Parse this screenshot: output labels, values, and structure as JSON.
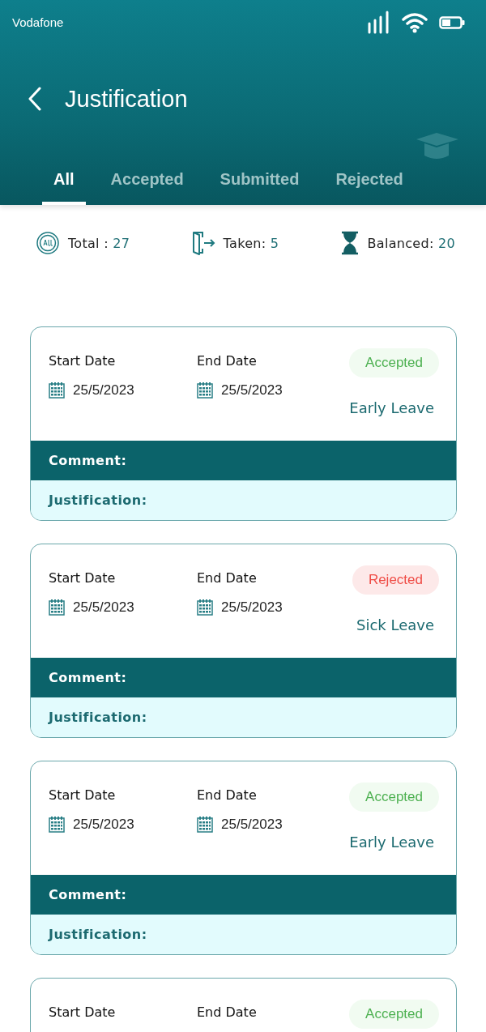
{
  "status_bar": {
    "carrier": "Vodafone"
  },
  "header": {
    "title": "Justification"
  },
  "tabs": [
    {
      "label": "All",
      "selected": true
    },
    {
      "label": "Accepted",
      "selected": false
    },
    {
      "label": "Submitted",
      "selected": false
    },
    {
      "label": "Rejected",
      "selected": false
    }
  ],
  "summary": [
    {
      "kind": "all",
      "label": "Total : ",
      "value": "27"
    },
    {
      "kind": "taken",
      "label": "Taken: ",
      "value": "5"
    },
    {
      "kind": "balanced",
      "label": "Balanced: ",
      "value": "20"
    }
  ],
  "cards": [
    {
      "start_label": "Start Date",
      "start_date": "25/5/2023",
      "end_label": "End Date",
      "end_date": "25/5/2023",
      "status": "Accepted",
      "kind": "accepted",
      "leave_type": "Early Leave",
      "comment_label": "Comment:",
      "justification_label": "Justification:"
    },
    {
      "start_label": "Start Date",
      "start_date": "25/5/2023",
      "end_label": "End Date",
      "end_date": "25/5/2023",
      "status": "Rejected",
      "kind": "rejected",
      "leave_type": "Sick Leave",
      "comment_label": "Comment:",
      "justification_label": "Justification:"
    },
    {
      "start_label": "Start Date",
      "start_date": "25/5/2023",
      "end_label": "End Date",
      "end_date": "25/5/2023",
      "status": "Accepted",
      "kind": "accepted",
      "leave_type": "Early Leave",
      "comment_label": "Comment:",
      "justification_label": "Justification:"
    },
    {
      "start_label": "Start Date",
      "end_label": "End Date",
      "status": "Accepted",
      "kind": "accepted"
    }
  ]
}
